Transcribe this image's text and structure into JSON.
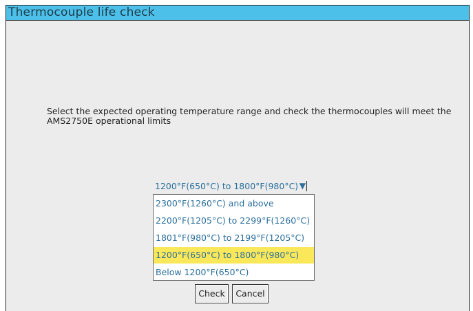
{
  "window": {
    "title": "Thermocouple life check"
  },
  "instructions": "Select the expected operating temperature range and check the thermocouples will meet the AMS2750E operational limits",
  "dropdown": {
    "selected_value": "1200°F(650°C) to 1800°F(980°C)",
    "arrow_icon": "triangle-down",
    "options": [
      {
        "label": "2300°F(1260°C) and above",
        "selected": false
      },
      {
        "label": "2200°F(1205°C) to 2299°F(1260°C)",
        "selected": false
      },
      {
        "label": "1801°F(980°C) to 2199°F(1205°C)",
        "selected": false
      },
      {
        "label": "1200°F(650°C) to 1800°F(980°C)",
        "selected": true
      },
      {
        "label": "Below 1200°F(650°C)",
        "selected": false
      }
    ]
  },
  "buttons": {
    "check_label": "Check",
    "cancel_label": "Cancel"
  },
  "colors": {
    "title_bar": "#4cc0e8",
    "background": "#ececec",
    "option_text": "#2b6f9c",
    "selected_highlight": "#fbe85a"
  }
}
